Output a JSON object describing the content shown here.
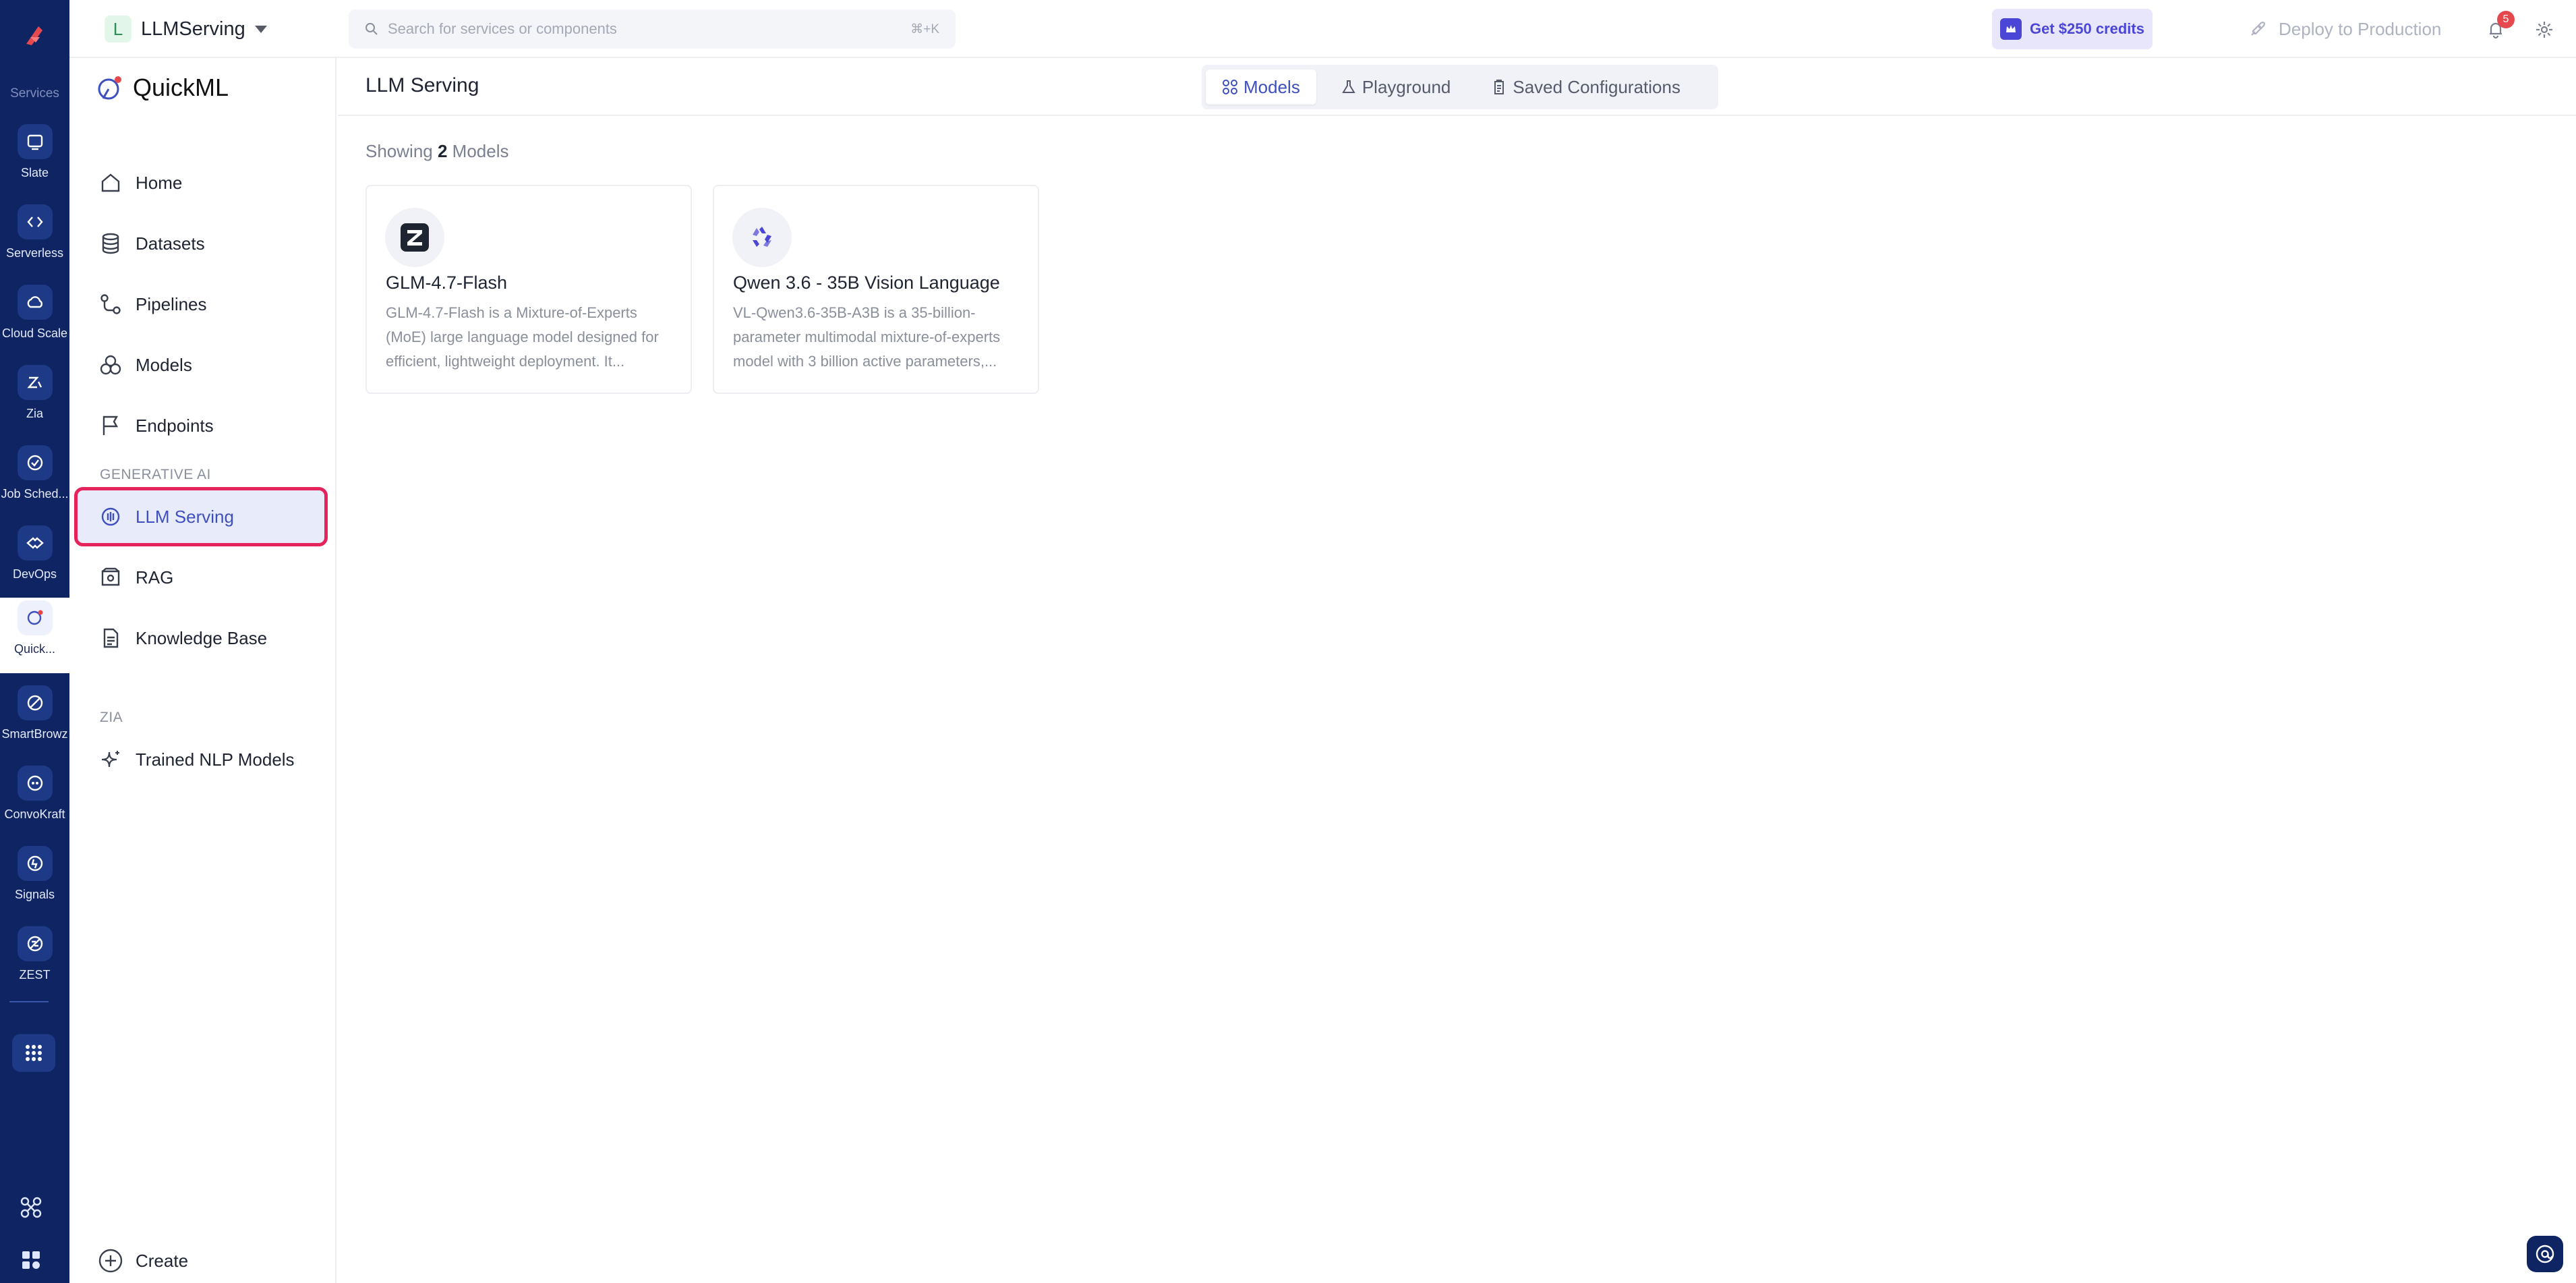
{
  "rail": {
    "title": "Services",
    "items": [
      {
        "label": "Slate",
        "icon": "slate-icon"
      },
      {
        "label": "Serverless",
        "icon": "serverless-icon"
      },
      {
        "label": "Cloud Scale",
        "icon": "cloud-scale-icon"
      },
      {
        "label": "Zia",
        "icon": "zia-icon"
      },
      {
        "label": "Job Sched...",
        "icon": "job-scheduling-icon"
      },
      {
        "label": "DevOps",
        "icon": "devops-icon"
      },
      {
        "label": "Quick...",
        "icon": "quickml-icon",
        "active": true
      },
      {
        "label": "SmartBrowz",
        "icon": "smartbrowz-icon"
      },
      {
        "label": "ConvoKraft",
        "icon": "convokraft-icon"
      },
      {
        "label": "Signals",
        "icon": "signals-icon"
      },
      {
        "label": "ZEST",
        "icon": "zest-icon"
      }
    ]
  },
  "topbar": {
    "project_initial": "L",
    "project_name": "LLMServing",
    "search_placeholder": "Search for services or components",
    "search_shortcut": "⌘+K",
    "credits_label": "Get $250 credits",
    "deploy_label": "Deploy to Production",
    "notification_count": "5"
  },
  "sidenav": {
    "brand": "QuickML",
    "items": [
      {
        "label": "Home",
        "icon": "home-icon"
      },
      {
        "label": "Datasets",
        "icon": "database-icon"
      },
      {
        "label": "Pipelines",
        "icon": "pipeline-icon"
      },
      {
        "label": "Models",
        "icon": "models-icon"
      },
      {
        "label": "Endpoints",
        "icon": "flag-icon"
      }
    ],
    "section_generative": "GENERATIVE AI",
    "generative_items": [
      {
        "label": "LLM Serving",
        "icon": "llm-serving-icon",
        "active": true
      },
      {
        "label": "RAG",
        "icon": "rag-icon"
      },
      {
        "label": "Knowledge Base",
        "icon": "document-icon"
      }
    ],
    "section_zia": "ZIA",
    "zia_items": [
      {
        "label": "Trained NLP Models",
        "icon": "sparkle-icon"
      }
    ],
    "create_label": "Create"
  },
  "main": {
    "title": "LLM Serving",
    "tabs": [
      {
        "label": "Models",
        "icon": "grid-icon",
        "active": true
      },
      {
        "label": "Playground",
        "icon": "flask-icon"
      },
      {
        "label": "Saved Configurations",
        "icon": "clipboard-icon"
      }
    ],
    "showing_prefix": "Showing",
    "showing_count": "2",
    "showing_suffix": "Models",
    "models": [
      {
        "name": "GLM-4.7-Flash",
        "icon": "zhipu-logo-icon",
        "description": "GLM-4.7-Flash is a Mixture-of-Experts (MoE) large language model designed for efficient, lightweight deployment. It..."
      },
      {
        "name": "Qwen 3.6 - 35B Vision Language",
        "icon": "qwen-logo-icon",
        "description": "VL-Qwen3.6-35B-A3B is a 35-billion-parameter multimodal mixture-of-experts model with 3 billion active parameters,..."
      }
    ]
  },
  "colors": {
    "rail_bg": "#0f2563",
    "accent": "#3e4fbe",
    "highlight_border": "#e5245b",
    "credits_accent": "#4b46d6"
  }
}
